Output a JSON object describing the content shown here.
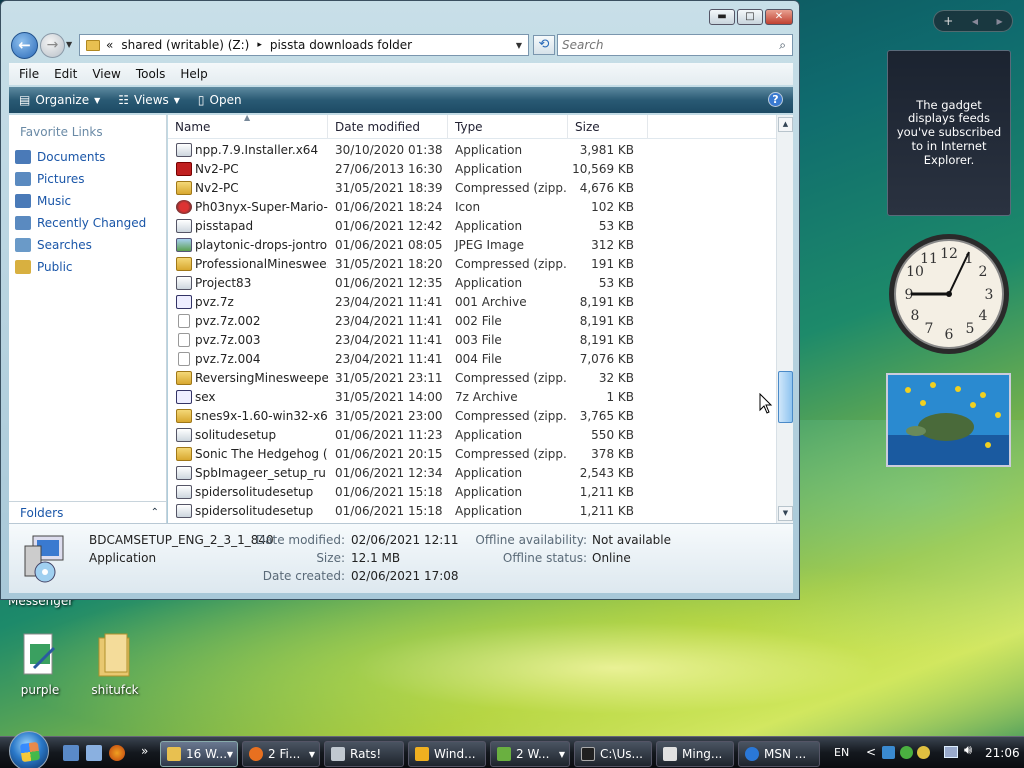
{
  "window": {
    "caption_buttons": {
      "minimize": "▬",
      "maximize": "□",
      "close": "✕"
    },
    "address": {
      "chevron": "«",
      "segments": [
        "shared (writable) (Z:)",
        "pissta downloads folder"
      ],
      "separator": "▸"
    },
    "search": {
      "placeholder": "Search"
    },
    "menu": [
      "File",
      "Edit",
      "View",
      "Tools",
      "Help"
    ],
    "commands": {
      "organize": "Organize",
      "views": "Views",
      "open": "Open"
    },
    "favorites": {
      "title": "Favorite Links",
      "items": [
        {
          "label": "Documents",
          "color": "#4a7ab8"
        },
        {
          "label": "Pictures",
          "color": "#5a8ac0"
        },
        {
          "label": "Music",
          "color": "#4a7ab8"
        },
        {
          "label": "Recently Changed",
          "color": "#5a8ac0"
        },
        {
          "label": "Searches",
          "color": "#6a9ac8"
        },
        {
          "label": "Public",
          "color": "#d8b040"
        }
      ],
      "folders_label": "Folders"
    },
    "columns": {
      "name": "Name",
      "date": "Date modified",
      "type": "Type",
      "size": "Size"
    },
    "files": [
      {
        "name": "npp.7.9.Installer.x64",
        "date": "30/10/2020 01:38",
        "type": "Application",
        "size": "3,981 KB",
        "icon": "app"
      },
      {
        "name": "Nv2-PC",
        "date": "27/06/2013 16:30",
        "type": "Application",
        "size": "10,569 KB",
        "icon": "flash"
      },
      {
        "name": "Nv2-PC",
        "date": "31/05/2021 18:39",
        "type": "Compressed (zipp...",
        "size": "4,676 KB",
        "icon": "zip"
      },
      {
        "name": "Ph03nyx-Super-Mario-...",
        "date": "01/06/2021 18:24",
        "type": "Icon",
        "size": "102 KB",
        "icon": "mario"
      },
      {
        "name": "pisstapad",
        "date": "01/06/2021 12:42",
        "type": "Application",
        "size": "53 KB",
        "icon": "app"
      },
      {
        "name": "playtonic-drops-jontron",
        "date": "01/06/2021 08:05",
        "type": "JPEG Image",
        "size": "312 KB",
        "icon": "img"
      },
      {
        "name": "ProfessionalMineswee...",
        "date": "31/05/2021 18:20",
        "type": "Compressed (zipp...",
        "size": "191 KB",
        "icon": "zip"
      },
      {
        "name": "Project83",
        "date": "01/06/2021 12:35",
        "type": "Application",
        "size": "53 KB",
        "icon": "app"
      },
      {
        "name": "pvz.7z",
        "date": "23/04/2021 11:41",
        "type": "001 Archive",
        "size": "8,191 KB",
        "icon": "7z"
      },
      {
        "name": "pvz.7z.002",
        "date": "23/04/2021 11:41",
        "type": "002 File",
        "size": "8,191 KB",
        "icon": "file"
      },
      {
        "name": "pvz.7z.003",
        "date": "23/04/2021 11:41",
        "type": "003 File",
        "size": "8,191 KB",
        "icon": "file"
      },
      {
        "name": "pvz.7z.004",
        "date": "23/04/2021 11:41",
        "type": "004 File",
        "size": "7,076 KB",
        "icon": "file"
      },
      {
        "name": "ReversingMinesweeper...",
        "date": "31/05/2021 23:11",
        "type": "Compressed (zipp...",
        "size": "32 KB",
        "icon": "zip"
      },
      {
        "name": "sex",
        "date": "31/05/2021 14:00",
        "type": "7z Archive",
        "size": "1 KB",
        "icon": "7z"
      },
      {
        "name": "snes9x-1.60-win32-x64",
        "date": "31/05/2021 23:00",
        "type": "Compressed (zipp...",
        "size": "3,765 KB",
        "icon": "zip"
      },
      {
        "name": "solitudesetup",
        "date": "01/06/2021 11:23",
        "type": "Application",
        "size": "550 KB",
        "icon": "app"
      },
      {
        "name": "Sonic The Hedgehog (...",
        "date": "01/06/2021 20:15",
        "type": "Compressed (zipp...",
        "size": "378 KB",
        "icon": "zip"
      },
      {
        "name": "SpbImageer_setup_ru",
        "date": "01/06/2021 12:34",
        "type": "Application",
        "size": "2,543 KB",
        "icon": "app"
      },
      {
        "name": "spidersolitudesetup",
        "date": "01/06/2021 15:18",
        "type": "Application",
        "size": "1,211 KB",
        "icon": "app"
      },
      {
        "name": "spidersolitudesetup",
        "date": "01/06/2021 15:18",
        "type": "Application",
        "size": "1,211 KB",
        "icon": "app"
      }
    ],
    "details": {
      "name": "BDCAMSETUP_ENG_2_3_1_840",
      "type": "Application",
      "date_modified_label": "Date modified:",
      "date_modified": "02/06/2021 12:11",
      "size_label": "Size:",
      "size": "12.1 MB",
      "date_created_label": "Date created:",
      "date_created": "02/06/2021 17:08",
      "offline_avail_label": "Offline availability:",
      "offline_avail": "Not available",
      "offline_status_label": "Offline status:",
      "offline_status": "Online"
    }
  },
  "sidebar": {
    "toolbar": {
      "add": "+",
      "prev": "◀",
      "next": "▶"
    },
    "feed_text": "The gadget displays feeds you've subscribed to in Internet Explorer."
  },
  "desktop": {
    "messenger_label": "Messenger",
    "icons": [
      {
        "label": "purple"
      },
      {
        "label": "shitufck"
      }
    ]
  },
  "taskbar": {
    "buttons": [
      {
        "label": "16 W...",
        "color": "#e8c050"
      },
      {
        "label": "2 Fi...",
        "color": "#e87020"
      },
      {
        "label": "Rats!",
        "color": "#c0c8d0"
      },
      {
        "label": "Wind...",
        "color": "#f0b020"
      },
      {
        "label": "2 W...",
        "color": "#6ab040"
      },
      {
        "label": "C:\\Us...",
        "color": "#202020"
      },
      {
        "label": "Ming...",
        "color": "#e0e0e0"
      },
      {
        "label": "MSN ...",
        "color": "#2a78d8"
      }
    ],
    "lang": "EN",
    "clock": "21:06",
    "more_glyph": "»",
    "tray_glyphs": {
      "chevron": "<"
    }
  }
}
